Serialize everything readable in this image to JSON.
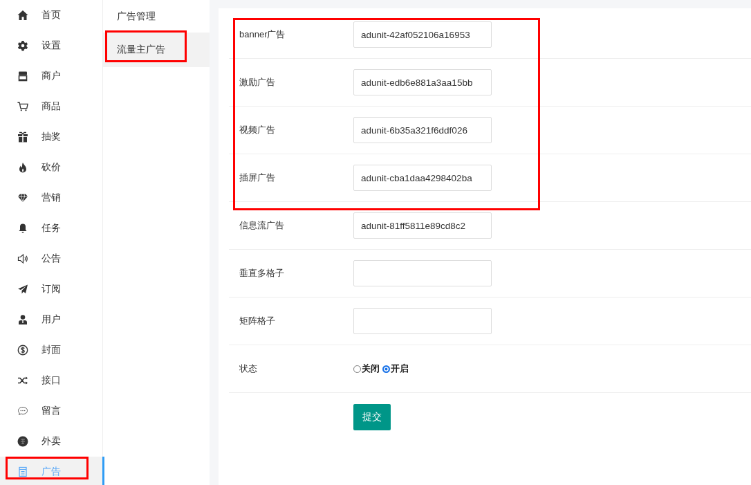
{
  "sidebar": {
    "items": [
      {
        "label": "首页",
        "selected": false,
        "highlighted": false
      },
      {
        "label": "设置",
        "selected": false,
        "highlighted": false
      },
      {
        "label": "商户",
        "selected": false,
        "highlighted": false
      },
      {
        "label": "商品",
        "selected": false,
        "highlighted": false
      },
      {
        "label": "抽奖",
        "selected": false,
        "highlighted": false
      },
      {
        "label": "砍价",
        "selected": false,
        "highlighted": false
      },
      {
        "label": "营销",
        "selected": false,
        "highlighted": false
      },
      {
        "label": "任务",
        "selected": false,
        "highlighted": false
      },
      {
        "label": "公告",
        "selected": false,
        "highlighted": false
      },
      {
        "label": "订阅",
        "selected": false,
        "highlighted": false
      },
      {
        "label": "用户",
        "selected": false,
        "highlighted": false
      },
      {
        "label": "封面",
        "selected": false,
        "highlighted": false
      },
      {
        "label": "接口",
        "selected": false,
        "highlighted": false
      },
      {
        "label": "留言",
        "selected": false,
        "highlighted": false
      },
      {
        "label": "外卖",
        "selected": false,
        "highlighted": false
      },
      {
        "label": "广告",
        "selected": true,
        "highlighted": true
      }
    ]
  },
  "submenu": {
    "items": [
      {
        "label": "广告管理",
        "selected": false,
        "highlighted": false
      },
      {
        "label": "流量主广告",
        "selected": true,
        "highlighted": true
      }
    ]
  },
  "form": {
    "fields": [
      {
        "kind": "text",
        "label": "banner广告",
        "value": "adunit-42af052106a16953",
        "highlighted": true
      },
      {
        "kind": "text",
        "label": "激励广告",
        "value": "adunit-edb6e881a3aa15bb",
        "highlighted": true
      },
      {
        "kind": "text",
        "label": "视频广告",
        "value": "adunit-6b35a321f6ddf026",
        "highlighted": true
      },
      {
        "kind": "text",
        "label": "插屏广告",
        "value": "adunit-cba1daa4298402ba",
        "highlighted": true
      },
      {
        "kind": "text",
        "label": "信息流广告",
        "value": "adunit-81ff5811e89cd8c2",
        "highlighted": false
      },
      {
        "kind": "text",
        "label": "垂直多格子",
        "highlighted": false
      },
      {
        "kind": "text",
        "label": "矩阵格子",
        "highlighted": false
      },
      {
        "kind": "radio",
        "label": "状态",
        "highlighted": false,
        "options": [
          {
            "label": "关闭",
            "selected": false
          },
          {
            "label": "开启",
            "selected": true
          }
        ]
      }
    ],
    "submit": "提交"
  }
}
